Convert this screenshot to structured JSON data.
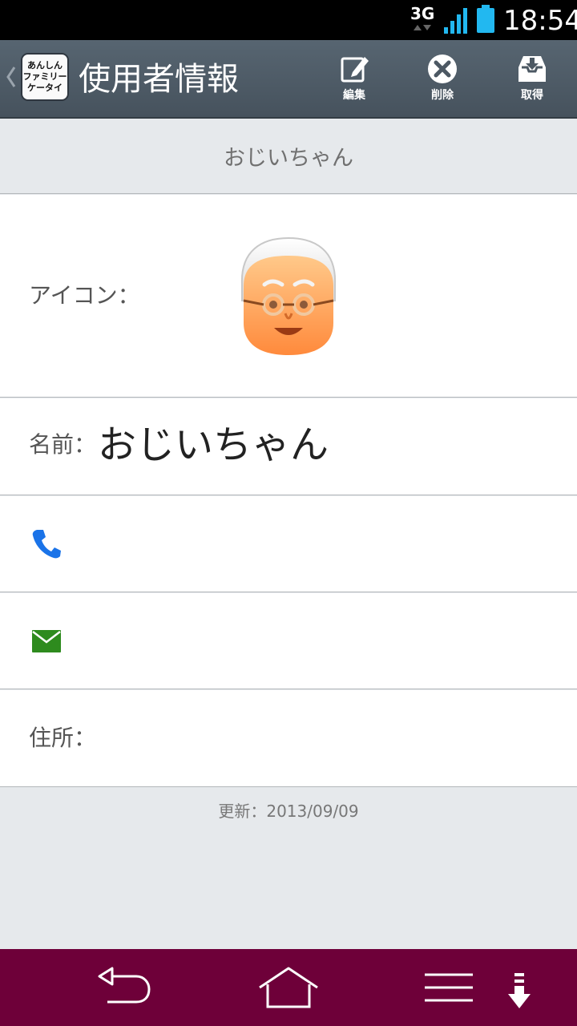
{
  "status_bar": {
    "network": "3G",
    "time": "18:54"
  },
  "action_bar": {
    "logo_text": "あんしん\nファミリー\nケータイ",
    "title": "使用者情報",
    "edit_label": "編集",
    "delete_label": "削除",
    "get_label": "取得"
  },
  "header": {
    "name": "おじいちゃん"
  },
  "fields": {
    "icon_label": "アイコン：",
    "name_label": "名前：",
    "name_value": "おじいちゃん",
    "address_label": "住所："
  },
  "footer": {
    "updated": "更新：2013/09/09"
  },
  "icons": {
    "phone": "phone-icon",
    "mail": "mail-icon",
    "avatar": "grandpa-avatar-icon"
  },
  "colors": {
    "action_bar": "#505c67",
    "nav_bar": "#6e0039",
    "phone": "#1a73e8",
    "mail": "#2e8b1e",
    "battery": "#22b8f0"
  }
}
